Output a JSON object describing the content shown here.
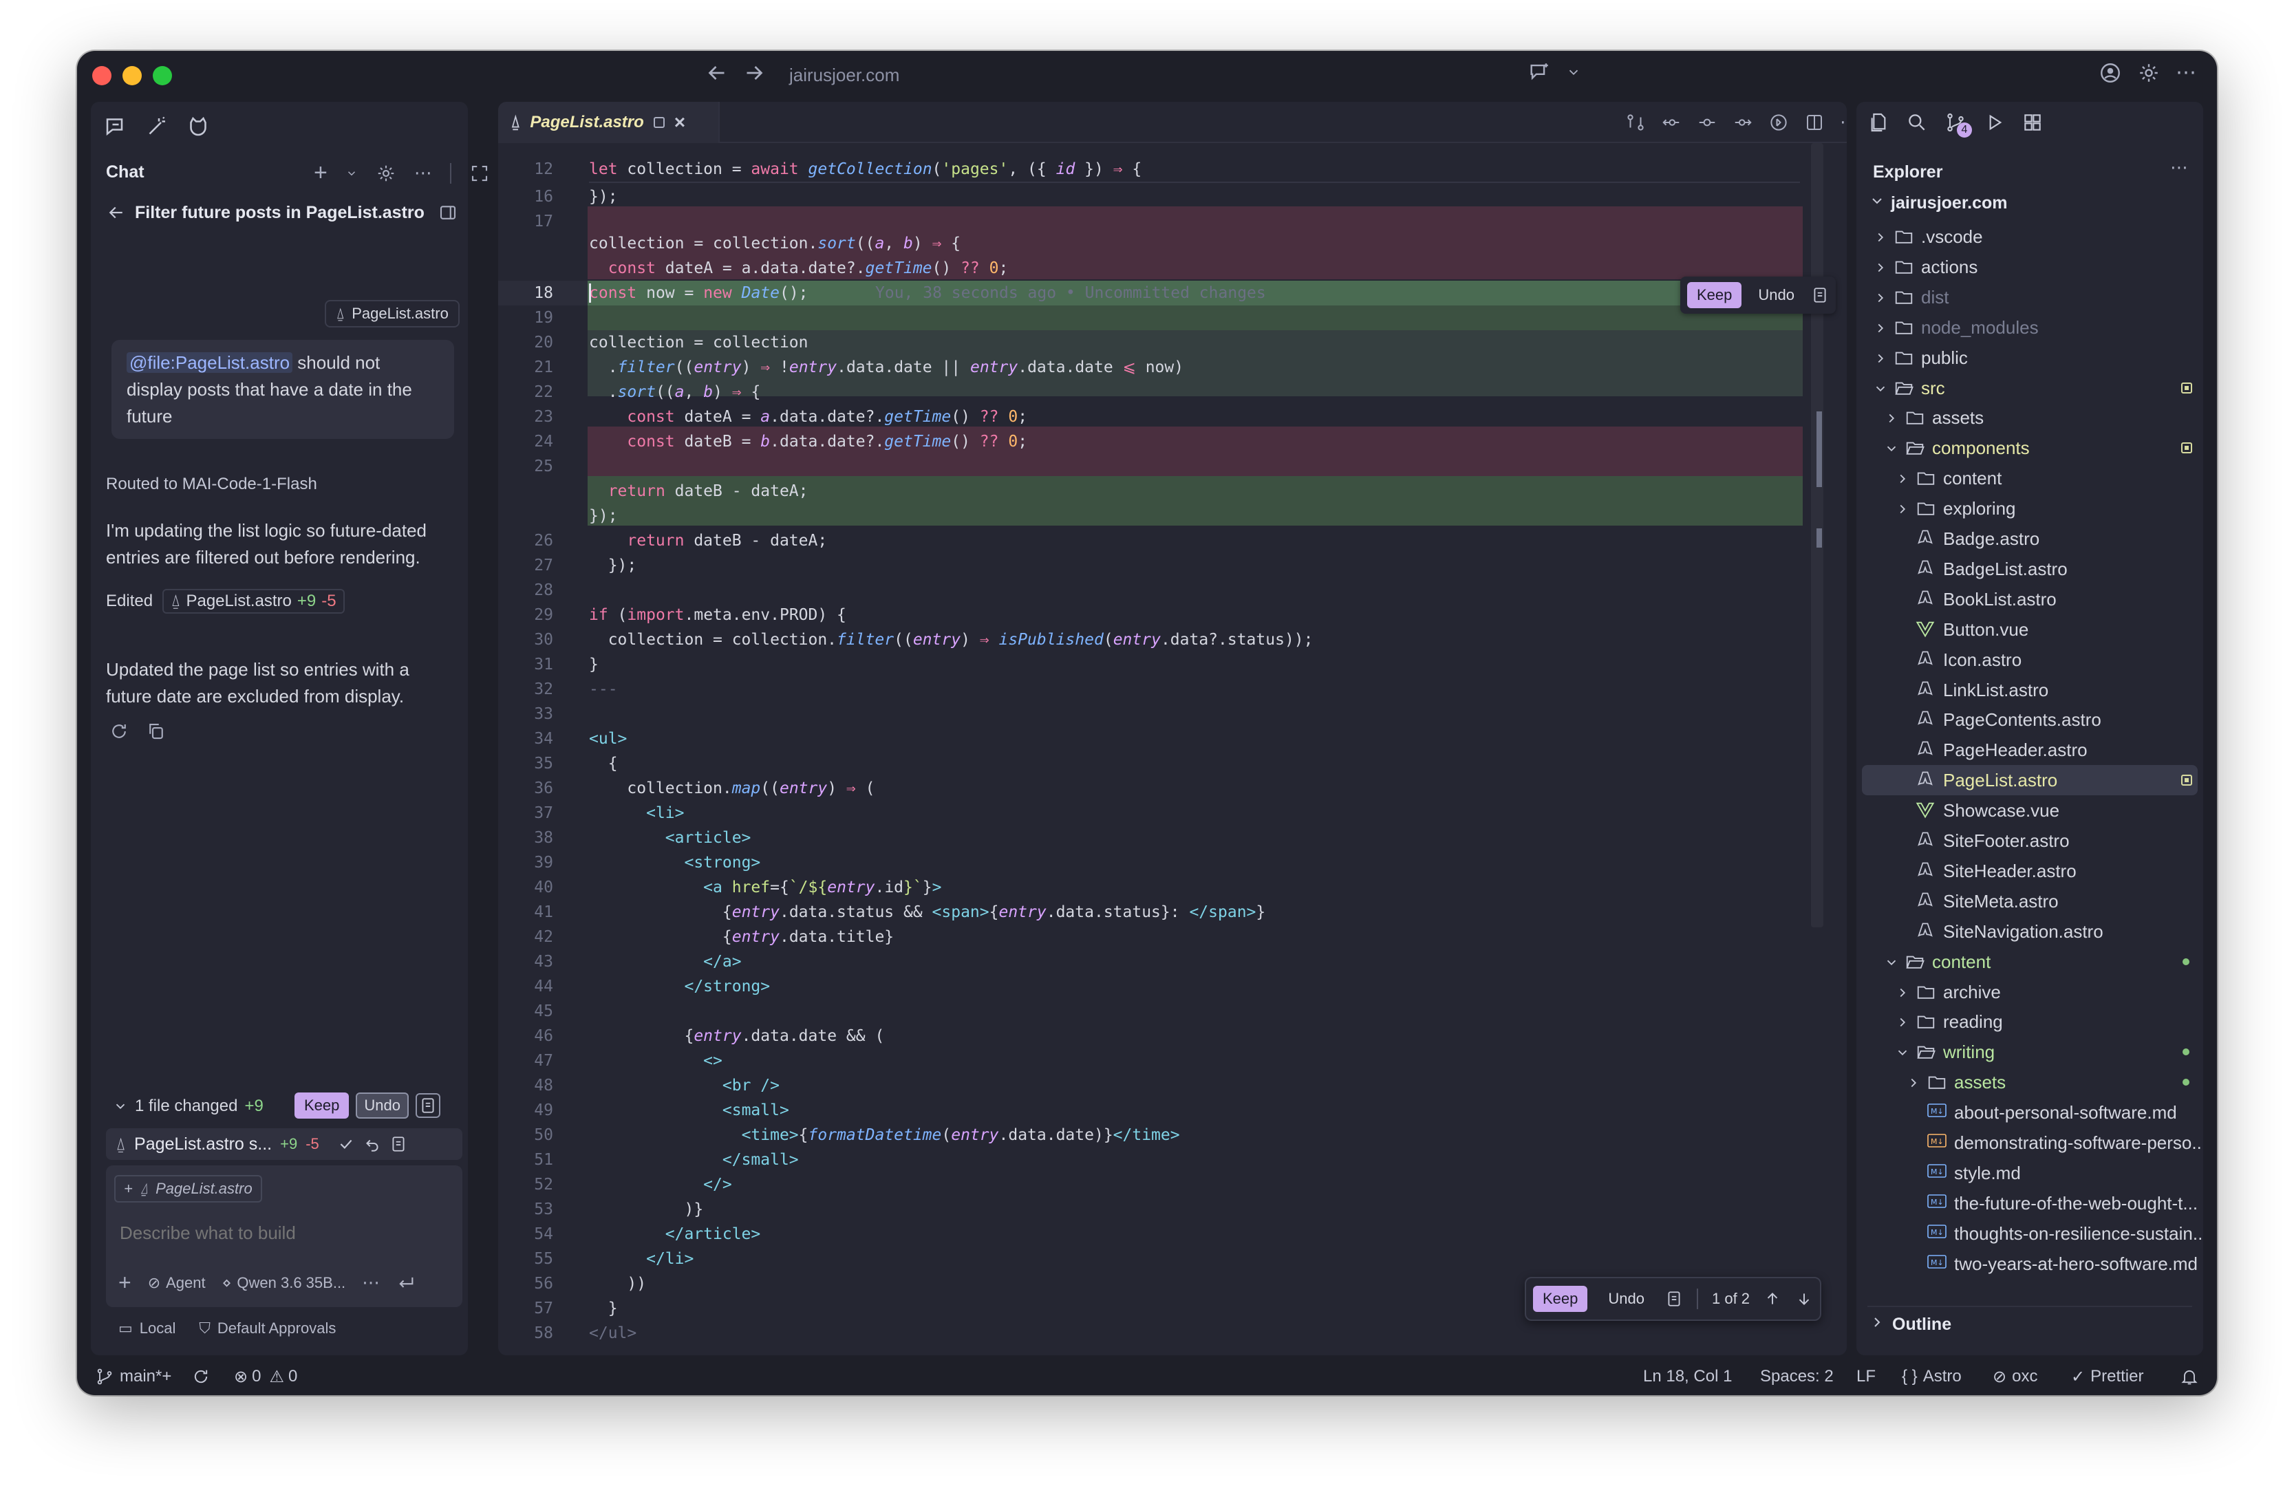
{
  "window": {
    "url": "jairusjoer.com"
  },
  "chat": {
    "title": "Chat",
    "thread_title": "Filter future posts in PageList.astro",
    "attachment_chip": "PageList.astro",
    "user_message_mention": "@file:PageList.astro",
    "user_message_text": " should not display posts that have a date in the future",
    "routed": "Routed to MAI-Code-1-Flash",
    "assistant_msg1": "I'm updating the list logic so future-dated entries are filtered out before rendering.",
    "edited_label": "Edited",
    "edited_file": "PageList.astro",
    "edited_add": "+9",
    "edited_del": "-5",
    "assistant_msg2": "Updated the page list so entries with a future date are excluded from display.",
    "changes": {
      "summary": "1 file changed",
      "add": "+9",
      "keep": "Keep",
      "undo": "Undo",
      "file": "PageList.astro s...",
      "file_add": "+9",
      "file_del": "-5"
    },
    "input": {
      "context_chip": "PageList.astro",
      "placeholder": "Describe what to build",
      "mode": "Agent",
      "model": "Qwen 3.6 35B..."
    },
    "footer": {
      "local": "Local",
      "approvals": "Default Approvals"
    }
  },
  "editor": {
    "tab": "PageList.astro",
    "inline_keep": "Keep",
    "inline_undo": "Undo",
    "blame": "You, 38 seconds ago • Uncommitted changes",
    "bottom": {
      "keep": "Keep",
      "undo": "Undo",
      "counter": "1 of 2"
    }
  },
  "explorer": {
    "title": "Explorer",
    "root": "jairusjoer.com",
    "items": [
      {
        "label": ".vscode",
        "depth": 0,
        "kind": "folder"
      },
      {
        "label": "actions",
        "depth": 0,
        "kind": "folder"
      },
      {
        "label": "dist",
        "depth": 0,
        "kind": "folder",
        "dim": true
      },
      {
        "label": "node_modules",
        "depth": 0,
        "kind": "folder",
        "dim": true
      },
      {
        "label": "public",
        "depth": 0,
        "kind": "folder"
      },
      {
        "label": "src",
        "depth": 0,
        "kind": "folder-open",
        "color": "#e6e8a8",
        "badge": "square"
      },
      {
        "label": "assets",
        "depth": 1,
        "kind": "folder"
      },
      {
        "label": "components",
        "depth": 1,
        "kind": "folder-open",
        "color": "#e6e8a8",
        "badge": "square"
      },
      {
        "label": "content",
        "depth": 2,
        "kind": "folder"
      },
      {
        "label": "exploring",
        "depth": 2,
        "kind": "folder"
      },
      {
        "label": "Badge.astro",
        "depth": 2,
        "kind": "astro"
      },
      {
        "label": "BadgeList.astro",
        "depth": 2,
        "kind": "astro"
      },
      {
        "label": "BookList.astro",
        "depth": 2,
        "kind": "astro"
      },
      {
        "label": "Button.vue",
        "depth": 2,
        "kind": "vue"
      },
      {
        "label": "Icon.astro",
        "depth": 2,
        "kind": "astro"
      },
      {
        "label": "LinkList.astro",
        "depth": 2,
        "kind": "astro"
      },
      {
        "label": "PageContents.astro",
        "depth": 2,
        "kind": "astro"
      },
      {
        "label": "PageHeader.astro",
        "depth": 2,
        "kind": "astro"
      },
      {
        "label": "PageList.astro",
        "depth": 2,
        "kind": "astro",
        "color": "#e6e8a8",
        "selected": true,
        "badge": "square"
      },
      {
        "label": "Showcase.vue",
        "depth": 2,
        "kind": "vue"
      },
      {
        "label": "SiteFooter.astro",
        "depth": 2,
        "kind": "astro"
      },
      {
        "label": "SiteHeader.astro",
        "depth": 2,
        "kind": "astro"
      },
      {
        "label": "SiteMeta.astro",
        "depth": 2,
        "kind": "astro"
      },
      {
        "label": "SiteNavigation.astro",
        "depth": 2,
        "kind": "astro"
      },
      {
        "label": "content",
        "depth": 1,
        "kind": "folder-open",
        "color": "#b9e6a0",
        "badge": "dot"
      },
      {
        "label": "archive",
        "depth": 2,
        "kind": "folder"
      },
      {
        "label": "reading",
        "depth": 2,
        "kind": "folder"
      },
      {
        "label": "writing",
        "depth": 2,
        "kind": "folder-open",
        "color": "#b9e6a0",
        "badge": "dot"
      },
      {
        "label": "assets",
        "depth": 3,
        "kind": "folder",
        "color": "#b9e6a0",
        "badge": "dot"
      },
      {
        "label": "about-personal-software.md",
        "depth": 3,
        "kind": "md"
      },
      {
        "label": "demonstrating-software-perso...",
        "depth": 3,
        "kind": "md-orange"
      },
      {
        "label": "style.md",
        "depth": 3,
        "kind": "md"
      },
      {
        "label": "the-future-of-the-web-ought-t...",
        "depth": 3,
        "kind": "md"
      },
      {
        "label": "thoughts-on-resilience-sustain...",
        "depth": 3,
        "kind": "md"
      },
      {
        "label": "two-years-at-hero-software.md",
        "depth": 3,
        "kind": "md"
      }
    ],
    "outline": "Outline"
  },
  "status": {
    "branch": "main*+",
    "errors": "0",
    "warnings": "0",
    "position": "Ln 18, Col 1",
    "spaces": "Spaces: 2",
    "eol": "LF",
    "lang": "Astro",
    "linter": "oxc",
    "formatter": "Prettier"
  },
  "colors": {
    "accent": "#c8a7ee",
    "added_bg": "#3c5141",
    "removed_bg": "#4a2f3f",
    "window_bg": "#1e1f28",
    "panel_bg": "#252632"
  }
}
